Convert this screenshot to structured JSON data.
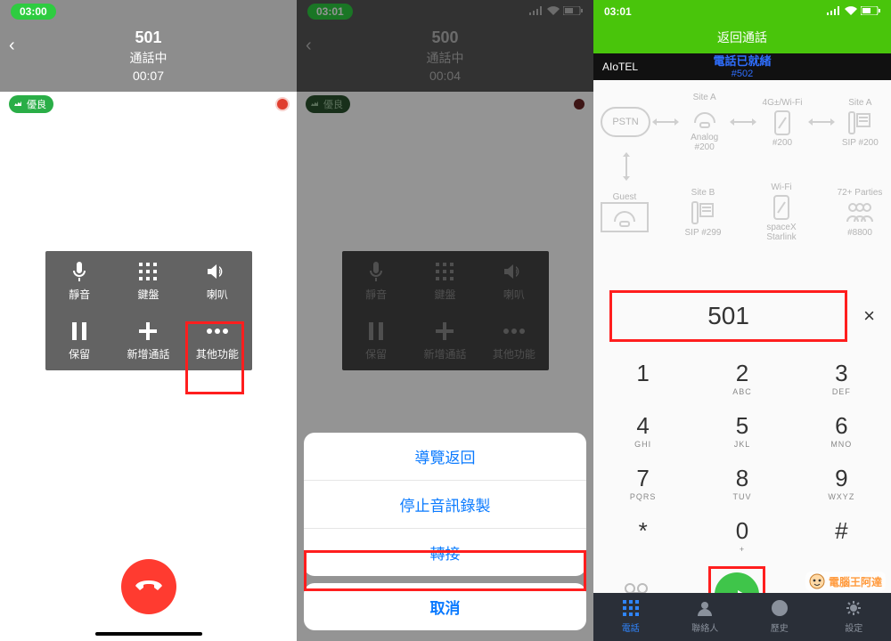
{
  "s1": {
    "time": "03:00",
    "number": "501",
    "state": "通話中",
    "duration": "00:07",
    "quality": "優良",
    "ctrl": {
      "mute": "靜音",
      "keypad": "鍵盤",
      "speaker": "喇叭",
      "hold": "保留",
      "add": "新增通話",
      "more": "其他功能"
    }
  },
  "s2": {
    "time": "03:01",
    "number": "500",
    "state": "通話中",
    "duration": "00:04",
    "quality": "優良",
    "ctrl": {
      "mute": "靜音",
      "keypad": "鍵盤",
      "speaker": "喇叭",
      "hold": "保留",
      "add": "新增通話",
      "more": "其他功能"
    },
    "sheet": {
      "navback": "導覽返回",
      "stoprec": "停止音訊錄製",
      "transfer": "轉接",
      "cancel": "取消"
    }
  },
  "s3": {
    "time": "03:01",
    "return_call": "返回通話",
    "brand": "AIoTEL",
    "ready": "電話已就緒",
    "ext": "#502",
    "diagram": {
      "r1": [
        {
          "name": "PSTN",
          "top": "",
          "bot": ""
        },
        {
          "name": "analog-phone",
          "top": "Site A",
          "bot": "Analog #200"
        },
        {
          "name": "4g-wifi",
          "top": "4G±/Wi-Fi",
          "bot": "#200"
        },
        {
          "name": "desk-phone",
          "top": "Site A",
          "bot": "SIP #200"
        }
      ],
      "r2": [
        {
          "name": "guest-phone",
          "top": "Guest",
          "bot": ""
        },
        {
          "name": "desk-phone",
          "top": "Site B",
          "bot": "SIP #299"
        },
        {
          "name": "wifi-phone",
          "top": "Wi-Fi",
          "bot": "spaceX Starlink"
        },
        {
          "name": "parties",
          "top": "72+ Parties",
          "bot": "#8800"
        }
      ]
    },
    "input": "501",
    "keypad": {
      "1": "",
      "2": "ABC",
      "3": "DEF",
      "4": "GHI",
      "5": "JKL",
      "6": "MNO",
      "7": "PQRS",
      "8": "TUV",
      "9": "WXYZ",
      "star": "*",
      "0": "+",
      "hash": "#"
    },
    "vm": "VM",
    "tabs": {
      "phone": "電話",
      "contacts": "聯絡人",
      "history": "歷史",
      "settings": "設定"
    }
  },
  "watermark": "電腦王阿達"
}
